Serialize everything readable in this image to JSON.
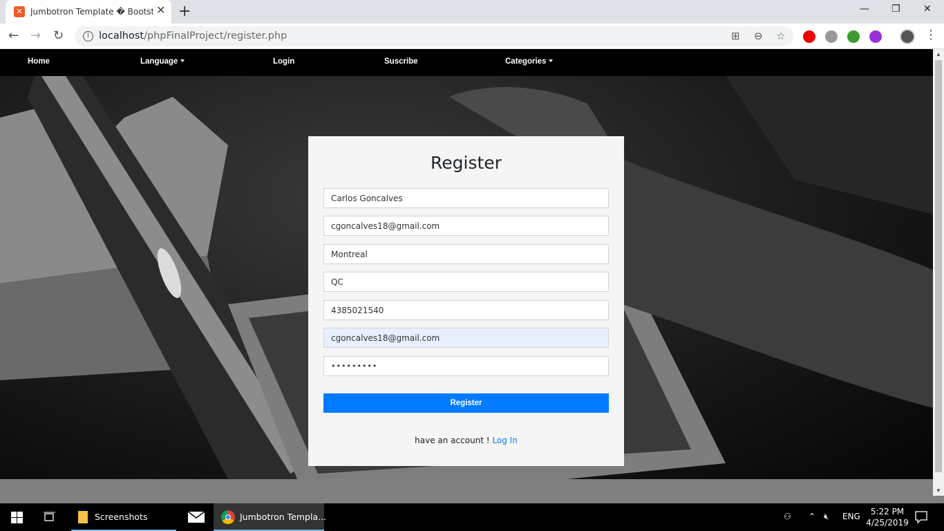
{
  "browser": {
    "tab_title": "Jumbotron Template � Bootstrap",
    "tab_favicon": "xampp-icon",
    "new_tab": "+",
    "close": "✕",
    "url_host": "localhost",
    "url_path": "/phpFinalProject/register.php",
    "window_controls": {
      "minimize": "—",
      "restore": "❐",
      "close": "✕"
    }
  },
  "site": {
    "nav": {
      "home": "Home",
      "language": "Language",
      "login": "Login",
      "subscribe": "Suscribe",
      "categories": "Categories"
    },
    "form": {
      "title": "Register",
      "name": "Carlos Goncalves",
      "email": "cgoncalves18@gmail.com",
      "city": "Montreal",
      "province": "QC",
      "phone": "4385021540",
      "email_confirm": "cgoncalves18@gmail.com",
      "password_mask": "•••••••••",
      "submit": "Register",
      "account_text": "have an account !",
      "login_link": "Log In"
    }
  },
  "taskbar": {
    "screenshots": "Screenshots",
    "chrome": "Jumbotron Templa...",
    "lang": "ENG",
    "time": "5:22 PM",
    "date": "4/25/2019"
  },
  "colors": {
    "primary": "#007bff",
    "nav_bg": "#000000",
    "card_bg": "#f5f5f5",
    "autofill": "#e8f0fe"
  }
}
